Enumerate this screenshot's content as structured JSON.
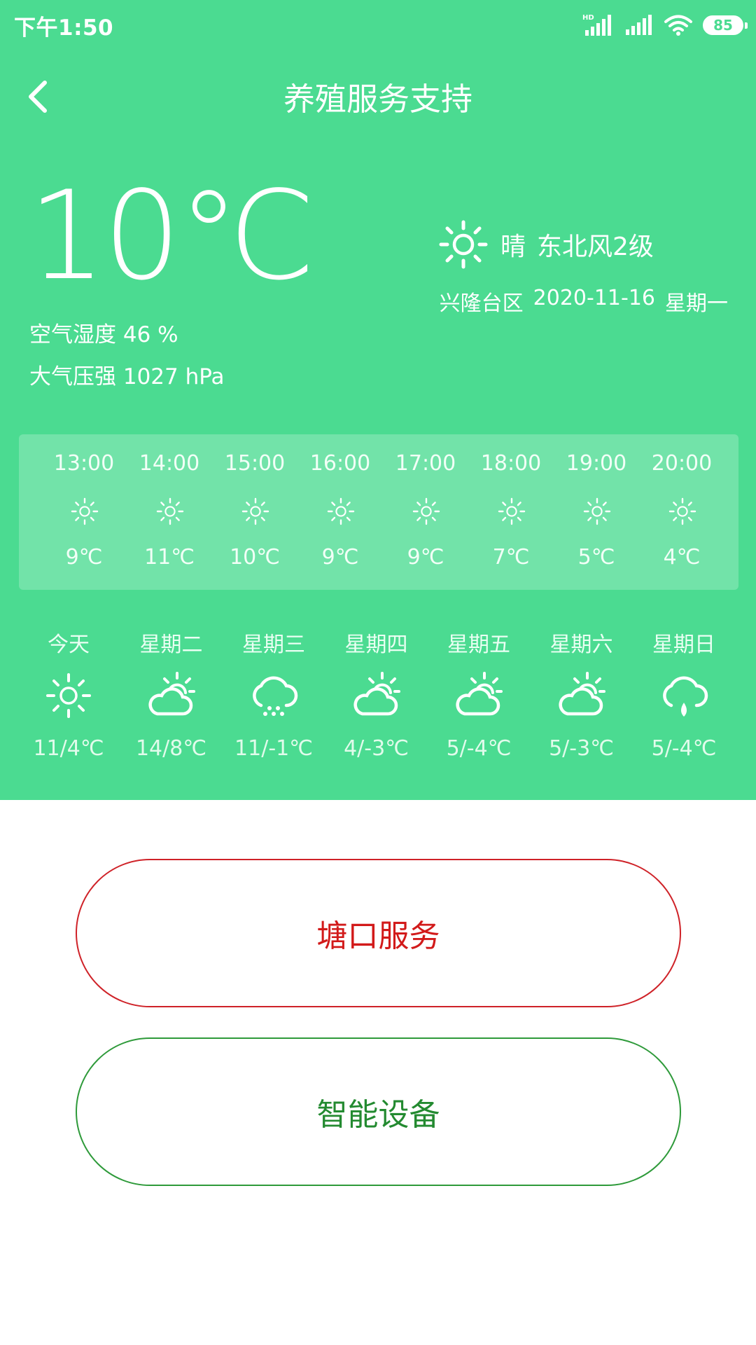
{
  "status_bar": {
    "time": "下午1:50",
    "battery": "85",
    "hd_label": "HD"
  },
  "header": {
    "title": "养殖服务支持"
  },
  "current": {
    "temperature": "10℃",
    "humidity_label": "空气湿度",
    "humidity_value": "46 %",
    "pressure_label": "大气压强",
    "pressure_value": "1027 hPa",
    "condition": "晴",
    "wind": "东北风2级",
    "location": "兴隆台区",
    "date": "2020-11-16",
    "weekday": "星期一",
    "icon": "sun-icon"
  },
  "hourly": [
    {
      "time": "13:00",
      "temp": "9℃",
      "icon": "sun-icon"
    },
    {
      "time": "14:00",
      "temp": "11℃",
      "icon": "sun-icon"
    },
    {
      "time": "15:00",
      "temp": "10℃",
      "icon": "sun-icon"
    },
    {
      "time": "16:00",
      "temp": "9℃",
      "icon": "sun-icon"
    },
    {
      "time": "17:00",
      "temp": "9℃",
      "icon": "sun-icon"
    },
    {
      "time": "18:00",
      "temp": "7℃",
      "icon": "sun-icon"
    },
    {
      "time": "19:00",
      "temp": "5℃",
      "icon": "sun-icon"
    },
    {
      "time": "20:00",
      "temp": "4℃",
      "icon": "sun-icon"
    }
  ],
  "daily": [
    {
      "day": "今天",
      "temp": "11/4℃",
      "icon": "sun-icon"
    },
    {
      "day": "星期二",
      "temp": "14/8℃",
      "icon": "partly-cloudy-icon"
    },
    {
      "day": "星期三",
      "temp": "11/-1℃",
      "icon": "snow-cloud-icon"
    },
    {
      "day": "星期四",
      "temp": "4/-3℃",
      "icon": "partly-cloudy-icon"
    },
    {
      "day": "星期五",
      "temp": "5/-4℃",
      "icon": "partly-cloudy-icon"
    },
    {
      "day": "星期六",
      "temp": "5/-3℃",
      "icon": "partly-cloudy-icon"
    },
    {
      "day": "星期日",
      "temp": "5/-4℃",
      "icon": "rain-cloud-icon"
    }
  ],
  "buttons": {
    "pond_service": "塘口服务",
    "smart_device": "智能设备"
  },
  "colors": {
    "header_bg": "#4bdb91",
    "pond_button": "#d21a1a",
    "device_button": "#238a30"
  }
}
